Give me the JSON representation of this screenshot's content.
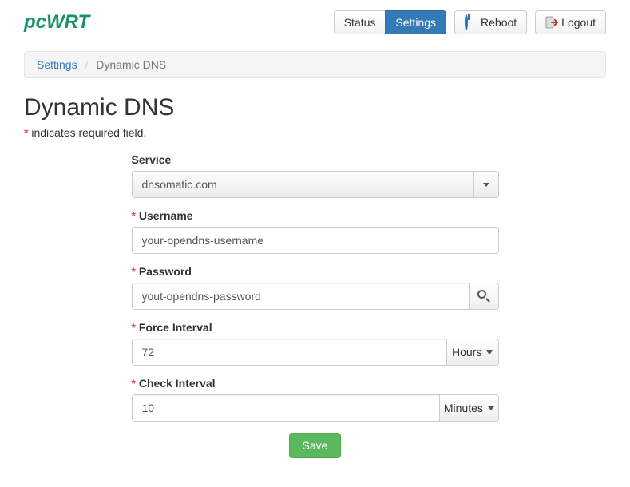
{
  "header": {
    "logo_text": "pcWRT",
    "nav": {
      "status": "Status",
      "settings": "Settings",
      "reboot": "Reboot",
      "logout": "Logout"
    }
  },
  "breadcrumb": {
    "root": "Settings",
    "current": "Dynamic DNS"
  },
  "page": {
    "title": "Dynamic DNS",
    "required_note": "indicates required field."
  },
  "form": {
    "service": {
      "label": "Service",
      "value": "dnsomatic.com"
    },
    "username": {
      "label": "Username",
      "value": "your-opendns-username"
    },
    "password": {
      "label": "Password",
      "value": "yout-opendns-password"
    },
    "force_interval": {
      "label": "Force Interval",
      "value": "72",
      "unit": "Hours"
    },
    "check_interval": {
      "label": "Check Interval",
      "value": "10",
      "unit": "Minutes"
    },
    "save_label": "Save"
  }
}
